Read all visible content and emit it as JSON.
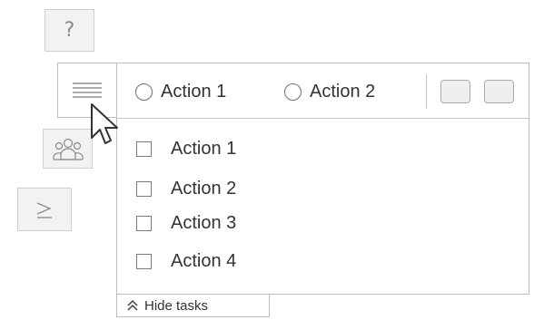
{
  "floating_tiles": {
    "help": {
      "glyph": "?",
      "icon": "question-mark-icon"
    },
    "people": {
      "icon": "people-group-icon"
    },
    "terminal": {
      "icon": "command-prompt-icon"
    }
  },
  "menu": {
    "icon": "hamburger-menu-icon"
  },
  "toolbar": {
    "radio_options": [
      {
        "label": "Action 1",
        "selected": false
      },
      {
        "label": "Action 2",
        "selected": false
      }
    ],
    "square_buttons": 2
  },
  "tasks": [
    {
      "label": "Action 1",
      "checked": false
    },
    {
      "label": "Action 2",
      "checked": false
    },
    {
      "label": "Action 3",
      "checked": false
    },
    {
      "label": "Action 4",
      "checked": false
    }
  ],
  "hide_tasks": {
    "label": "Hide tasks",
    "icon": "double-chevron-up-icon"
  },
  "colors": {
    "tile_background": "#f2f2f2",
    "border": "#bdbdbd",
    "text": "#333333"
  }
}
